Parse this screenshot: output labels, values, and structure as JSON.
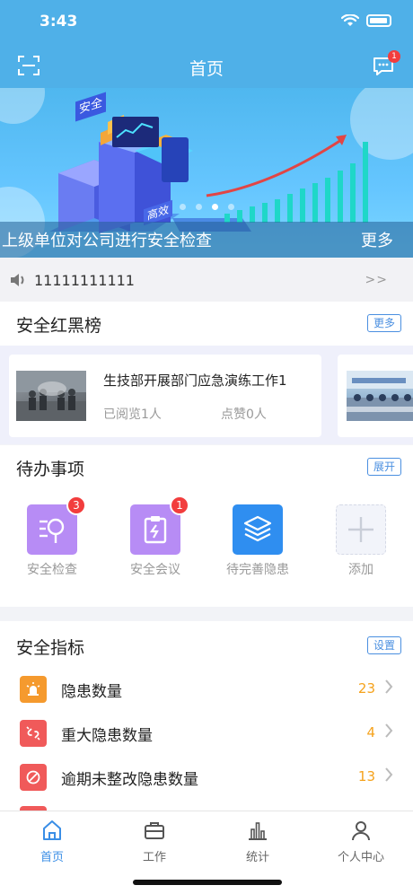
{
  "status_bar": {
    "time": "3:43"
  },
  "header": {
    "title": "首页",
    "message_badge": "1"
  },
  "banner": {
    "caption": "上级单位对公司进行安全检查",
    "more_label": "更多",
    "sign_safety": "安全",
    "sign_efficiency": "高效",
    "active_dot_index": 2,
    "dot_count": 4
  },
  "notice": {
    "text": "11111111111",
    "more": ">>"
  },
  "honor_board": {
    "title": "安全红黑榜",
    "more_label": "更多",
    "items": [
      {
        "title": "生技部开展部门应急演练工作1",
        "read": "已阅览1人",
        "likes": "点赞0人"
      }
    ]
  },
  "todo": {
    "title": "待办事项",
    "expand_label": "展开",
    "items": [
      {
        "label": "安全检查",
        "badge": "3",
        "color": "#b78cf5",
        "icon": "inspection-icon"
      },
      {
        "label": "安全会议",
        "badge": "1",
        "color": "#b78cf5",
        "icon": "meeting-icon"
      },
      {
        "label": "待完善隐患",
        "badge": "",
        "color": "#2f8ef0",
        "icon": "layers-icon"
      },
      {
        "label": "添加",
        "badge": "",
        "color": "#f2f4fa",
        "icon": "plus-icon"
      }
    ]
  },
  "indicators": {
    "title": "安全指标",
    "settings_label": "设置",
    "items": [
      {
        "label": "隐患数量",
        "value": "23",
        "color": "#f59a2e",
        "icon": "alarm-icon"
      },
      {
        "label": "重大隐患数量",
        "value": "4",
        "color": "#f05a5a",
        "icon": "broken-link-icon"
      },
      {
        "label": "逾期未整改隐患数量",
        "value": "13",
        "color": "#f05a5a",
        "icon": "forbidden-icon"
      }
    ]
  },
  "tabbar": {
    "items": [
      {
        "label": "首页",
        "icon": "home-icon",
        "active": true
      },
      {
        "label": "工作",
        "icon": "briefcase-icon",
        "active": false
      },
      {
        "label": "统计",
        "icon": "bar-chart-icon",
        "active": false
      },
      {
        "label": "个人中心",
        "icon": "person-icon",
        "active": false
      }
    ]
  },
  "colors": {
    "primary": "#4fb0e8",
    "accent": "#3a8ee6",
    "value": "#f5a21c",
    "badge": "#f23d3d"
  }
}
